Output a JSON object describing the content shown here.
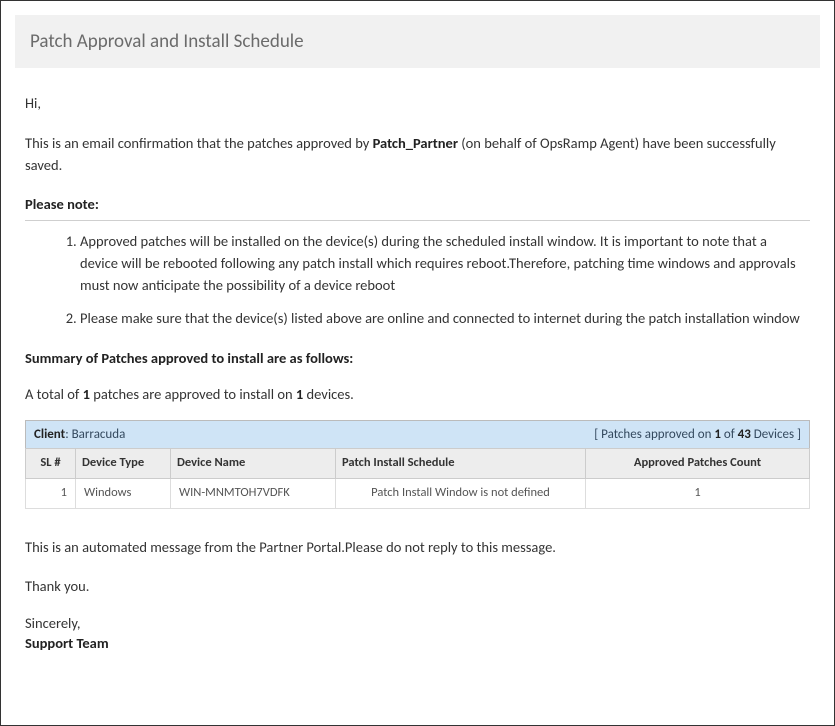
{
  "title": "Patch Approval and Install Schedule",
  "greeting": "Hi,",
  "intro": {
    "prefix": "This is an email confirmation that the patches approved by ",
    "partner": "Patch_Partner",
    "middle": " (on behalf of OpsRamp Agent) have been successfully saved."
  },
  "please_note_label": "Please note:",
  "notes": [
    "Approved patches will be installed on the device(s) during the scheduled install window. It is important to note that a device will be rebooted following any patch install which requires reboot.Therefore, patching time windows and approvals must now anticipate the possibility of a device reboot",
    "Please make sure that the device(s) listed above are online and connected to internet during the patch installation window"
  ],
  "summary_label": "Summary of Patches approved to install are as follows:",
  "summary_text": {
    "p1": "A total of ",
    "patches_count": "1",
    "p2": " patches are approved to install on ",
    "devices_count": "1",
    "p3": " devices."
  },
  "client_bar": {
    "client_label": "Client",
    "client_name": ": Barracuda",
    "approved_on_prefix": "[  Patches approved on ",
    "n1": "1",
    "of": " of ",
    "n2": "43",
    "suffix": " Devices ]"
  },
  "table": {
    "headers": {
      "sl": "SL #",
      "device_type": "Device Type",
      "device_name": "Device Name",
      "schedule": "Patch Install Schedule",
      "count": "Approved Patches Count"
    },
    "rows": [
      {
        "sl": "1",
        "device_type": "Windows",
        "device_name": "WIN-MNMTOH7VDFK",
        "schedule": "Patch Install Window is not defined",
        "count": "1"
      }
    ]
  },
  "automated": "This is an automated message from the Partner Portal.Please do not reply to this message.",
  "thankyou": "Thank you.",
  "signoff": {
    "sincerely": "Sincerely,",
    "team": "Support Team"
  }
}
